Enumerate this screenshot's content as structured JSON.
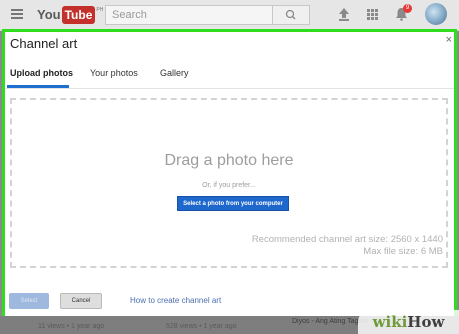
{
  "header": {
    "logo_you": "You",
    "logo_tube": "Tube",
    "logo_region": "PH",
    "search_placeholder": "Search",
    "notifications_count": "9"
  },
  "dialog": {
    "title": "Channel art",
    "tabs": [
      {
        "label": "Upload photos",
        "active": true
      },
      {
        "label": "Your photos",
        "active": false
      },
      {
        "label": "Gallery",
        "active": false
      }
    ],
    "dropzone": {
      "drag_text": "Drag a photo here",
      "or_text": "Or, if you prefer...",
      "select_button": "Select a photo from your computer",
      "recommended_size": "Recommended channel art size: 2560 x 1440",
      "max_size": "Max file size: 6 MB"
    }
  },
  "footer": {
    "select_label": "Select",
    "cancel_label": "Cancel",
    "help_link": "How to create channel art"
  },
  "background": {
    "views_1": "11 views • 1 year ago",
    "views_2": "528 views • 1 year ago",
    "video_title": "Diyos - Ang Ating Tagum"
  },
  "watermark": {
    "wiki": "wiki",
    "how": "How"
  },
  "colors": {
    "highlight": "#2fdc1e",
    "accent": "#1e67cc",
    "youtube_red": "#c4302b"
  }
}
